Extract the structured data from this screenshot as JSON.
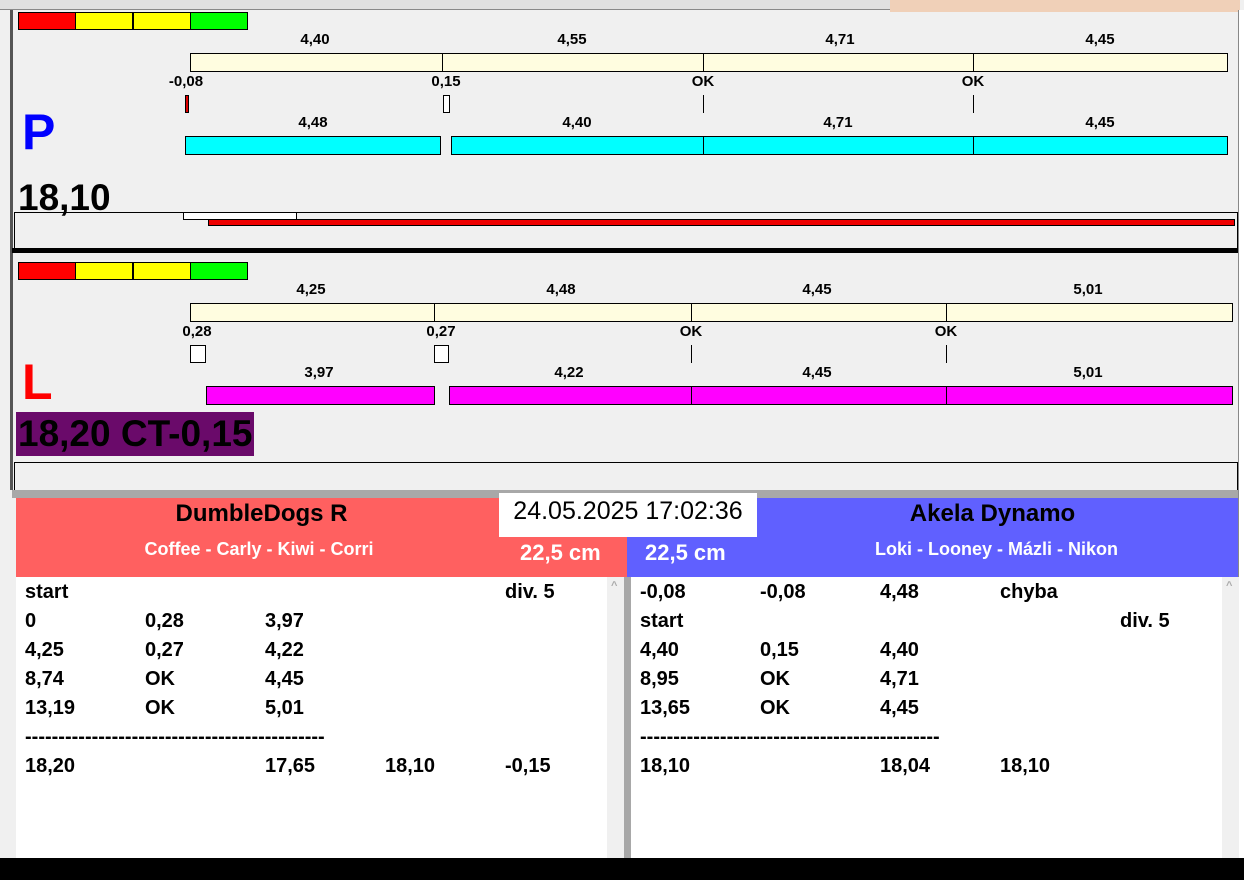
{
  "legend_colors": [
    "#ff0000",
    "#ffff00",
    "#ffff00",
    "#00ff00"
  ],
  "lanes": [
    {
      "letter": "P",
      "letter_color": "#0000ff",
      "bar_color": "#00ffff",
      "upper_labels": [
        "4,40",
        "4,55",
        "4,71",
        "4,45"
      ],
      "mid_labels": [
        "-0,08",
        "0,15",
        "OK",
        "OK"
      ],
      "lower_labels": [
        "4,48",
        "4,40",
        "4,71",
        "4,45"
      ],
      "total": "18,10"
    },
    {
      "letter": "L",
      "letter_color": "#ff0000",
      "bar_color": "#ff00ff",
      "upper_labels": [
        "4,25",
        "4,48",
        "4,45",
        "5,01"
      ],
      "mid_labels": [
        "0,28",
        "0,27",
        "OK",
        "OK"
      ],
      "lower_labels": [
        "3,97",
        "4,22",
        "4,45",
        "5,01"
      ],
      "total": "18,20 CT-0,15"
    }
  ],
  "datetime": "24.05.2025 17:02:36",
  "teams": [
    {
      "name": "DumbleDogs R",
      "dogs": "Coffee - Carly - Kiwi - Corri",
      "height": "22,5 cm",
      "color": "#ff6060",
      "rows": [
        [
          "start",
          "",
          "",
          "",
          "div.  5"
        ],
        [
          "0",
          "0,28",
          "3,97",
          "",
          ""
        ],
        [
          "4,25",
          "0,27",
          "4,22",
          "",
          ""
        ],
        [
          "8,74",
          "OK",
          "4,45",
          "",
          ""
        ],
        [
          "13,19",
          "OK",
          "5,01",
          "",
          ""
        ],
        [
          "---------------------------------------------",
          "",
          "",
          "",
          ""
        ],
        [
          "18,20",
          "",
          "17,65",
          "18,10",
          "-0,15"
        ]
      ]
    },
    {
      "name": "Akela Dynamo",
      "dogs": "Loki - Looney - Mázli - Nikon",
      "height": "22,5 cm",
      "color": "#6060ff",
      "rows": [
        [
          "-0,08",
          "-0,08",
          "4,48",
          "chyba",
          ""
        ],
        [
          "start",
          "",
          "",
          "",
          "div.  5"
        ],
        [
          "4,40",
          "0,15",
          "4,40",
          "",
          ""
        ],
        [
          "8,95",
          "OK",
          "4,71",
          "",
          ""
        ],
        [
          "13,65",
          "OK",
          "4,45",
          "",
          ""
        ],
        [
          "---------------------------------------------",
          "",
          "",
          "",
          ""
        ],
        [
          "18,10",
          "",
          "18,04",
          "18,10",
          ""
        ]
      ]
    }
  ]
}
